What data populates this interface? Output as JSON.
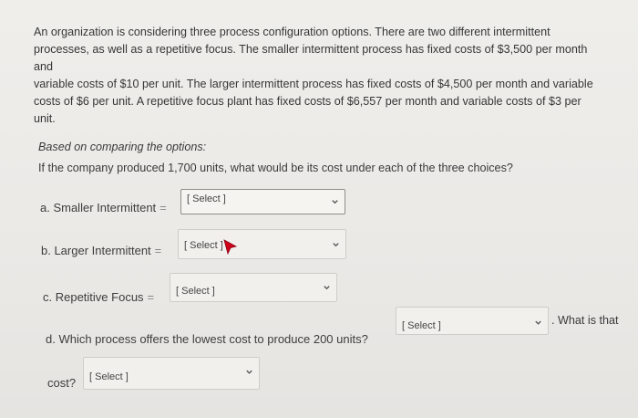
{
  "problem": {
    "line1": "An organization is considering three process configuration options. There are two different intermittent",
    "line2": "processes, as well as a repetitive focus. The smaller intermittent process has fixed costs of $3,500 per month and",
    "line3": "variable costs of $10 per unit. The larger intermittent process has fixed costs of $4,500 per month and variable",
    "line4": "costs of $6 per unit. A repetitive focus plant has fixed costs of $6,557 per month and variable costs of $3 per",
    "line5": "unit."
  },
  "subheading": "Based on comparing the options:",
  "question": "If the company produced 1,700 units, what would be its cost under each of the three choices?",
  "items": {
    "a": {
      "label": "a. Smaller Intermittent",
      "eq": "=",
      "select": "[ Select ]"
    },
    "b": {
      "label": "b. Larger Intermittent",
      "eq": "=",
      "select": "[ Select ]"
    },
    "c": {
      "label": "c. Repetitive Focus",
      "eq": "=",
      "select": "[ Select ]"
    },
    "d": {
      "label": "d. Which process offers the lowest cost to produce 200 units?",
      "select": "[ Select ]",
      "trailing": ". What is that"
    },
    "e": {
      "label": "cost?",
      "select": "[ Select ]"
    }
  },
  "icons": {
    "dropdown": "chevron-down-icon",
    "cursor": "mouse-pointer-icon"
  },
  "colors": {
    "background": "#ebe9e6",
    "text": "#363636",
    "select_border": "#cfcdc9",
    "cursor": "#d0021b"
  }
}
